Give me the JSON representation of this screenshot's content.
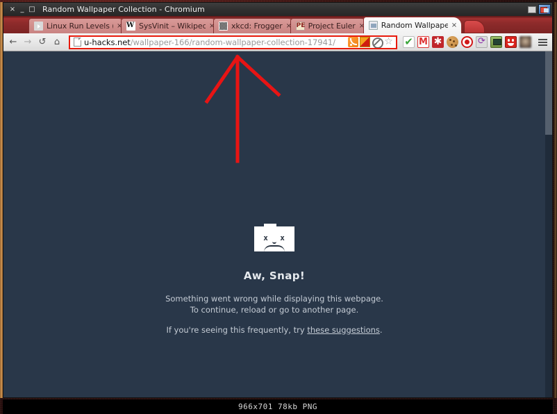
{
  "window": {
    "title": "Random Wallpaper Collection - Chromium",
    "close_glyph": "×",
    "minimize_glyph": "_",
    "maximize_glyph": "□"
  },
  "tabs": [
    {
      "label": "Linux Run Levels (Pa",
      "favicon": "youtube-icon",
      "close": "×",
      "active": false
    },
    {
      "label": "SysVinit – Wikipedia",
      "favicon": "wikipedia-icon",
      "close": "×",
      "active": false
    },
    {
      "label": "xkcd: Frogger",
      "favicon": "xkcd-icon",
      "close": "×",
      "active": false
    },
    {
      "label": "Project Euler",
      "favicon": "project-euler-icon",
      "close": "×",
      "active": false
    },
    {
      "label": "Random Wallpaper C",
      "favicon": "page-icon",
      "close": "×",
      "active": true
    }
  ],
  "toolbar": {
    "back_glyph": "←",
    "forward_glyph": "→",
    "reload_glyph": "↺",
    "home_glyph": "⌂",
    "menu_label": "menu"
  },
  "omnibox": {
    "host": "u-hacks.net",
    "path": "/wallpaper-166/random-wallpaper-collection-17941/",
    "icons": [
      "rss-icon",
      "flag-icon",
      "blocked-script-icon",
      "bookmark-star-icon"
    ]
  },
  "extensions": [
    {
      "name": "checkmark-icon"
    },
    {
      "name": "gmail-icon",
      "glyph": "M"
    },
    {
      "name": "asterisk-icon",
      "glyph": "✱"
    },
    {
      "name": "cookie-icon"
    },
    {
      "name": "stop-icon"
    },
    {
      "name": "refresh-icon",
      "glyph": "⟳"
    },
    {
      "name": "monitor-icon"
    },
    {
      "name": "smiley-face-icon"
    },
    {
      "name": "avatar-icon"
    }
  ],
  "error_page": {
    "icon": "sad-folder-icon",
    "eye_glyph": "x",
    "title": "Aw, Snap!",
    "line1": "Something went wrong while displaying this webpage.",
    "line2": "To continue, reload or go to another page.",
    "line3_prefix": "If you're seeing this frequently, try ",
    "link_text": "these suggestions",
    "line3_suffix": "."
  },
  "statusbar": {
    "text": "966x701  78kb  PNG"
  },
  "colors": {
    "page_background": "#293749",
    "tabstrip": "#8e2b2b",
    "omnibox_border": "#e81a0c",
    "annotation_arrow": "#e81414"
  }
}
